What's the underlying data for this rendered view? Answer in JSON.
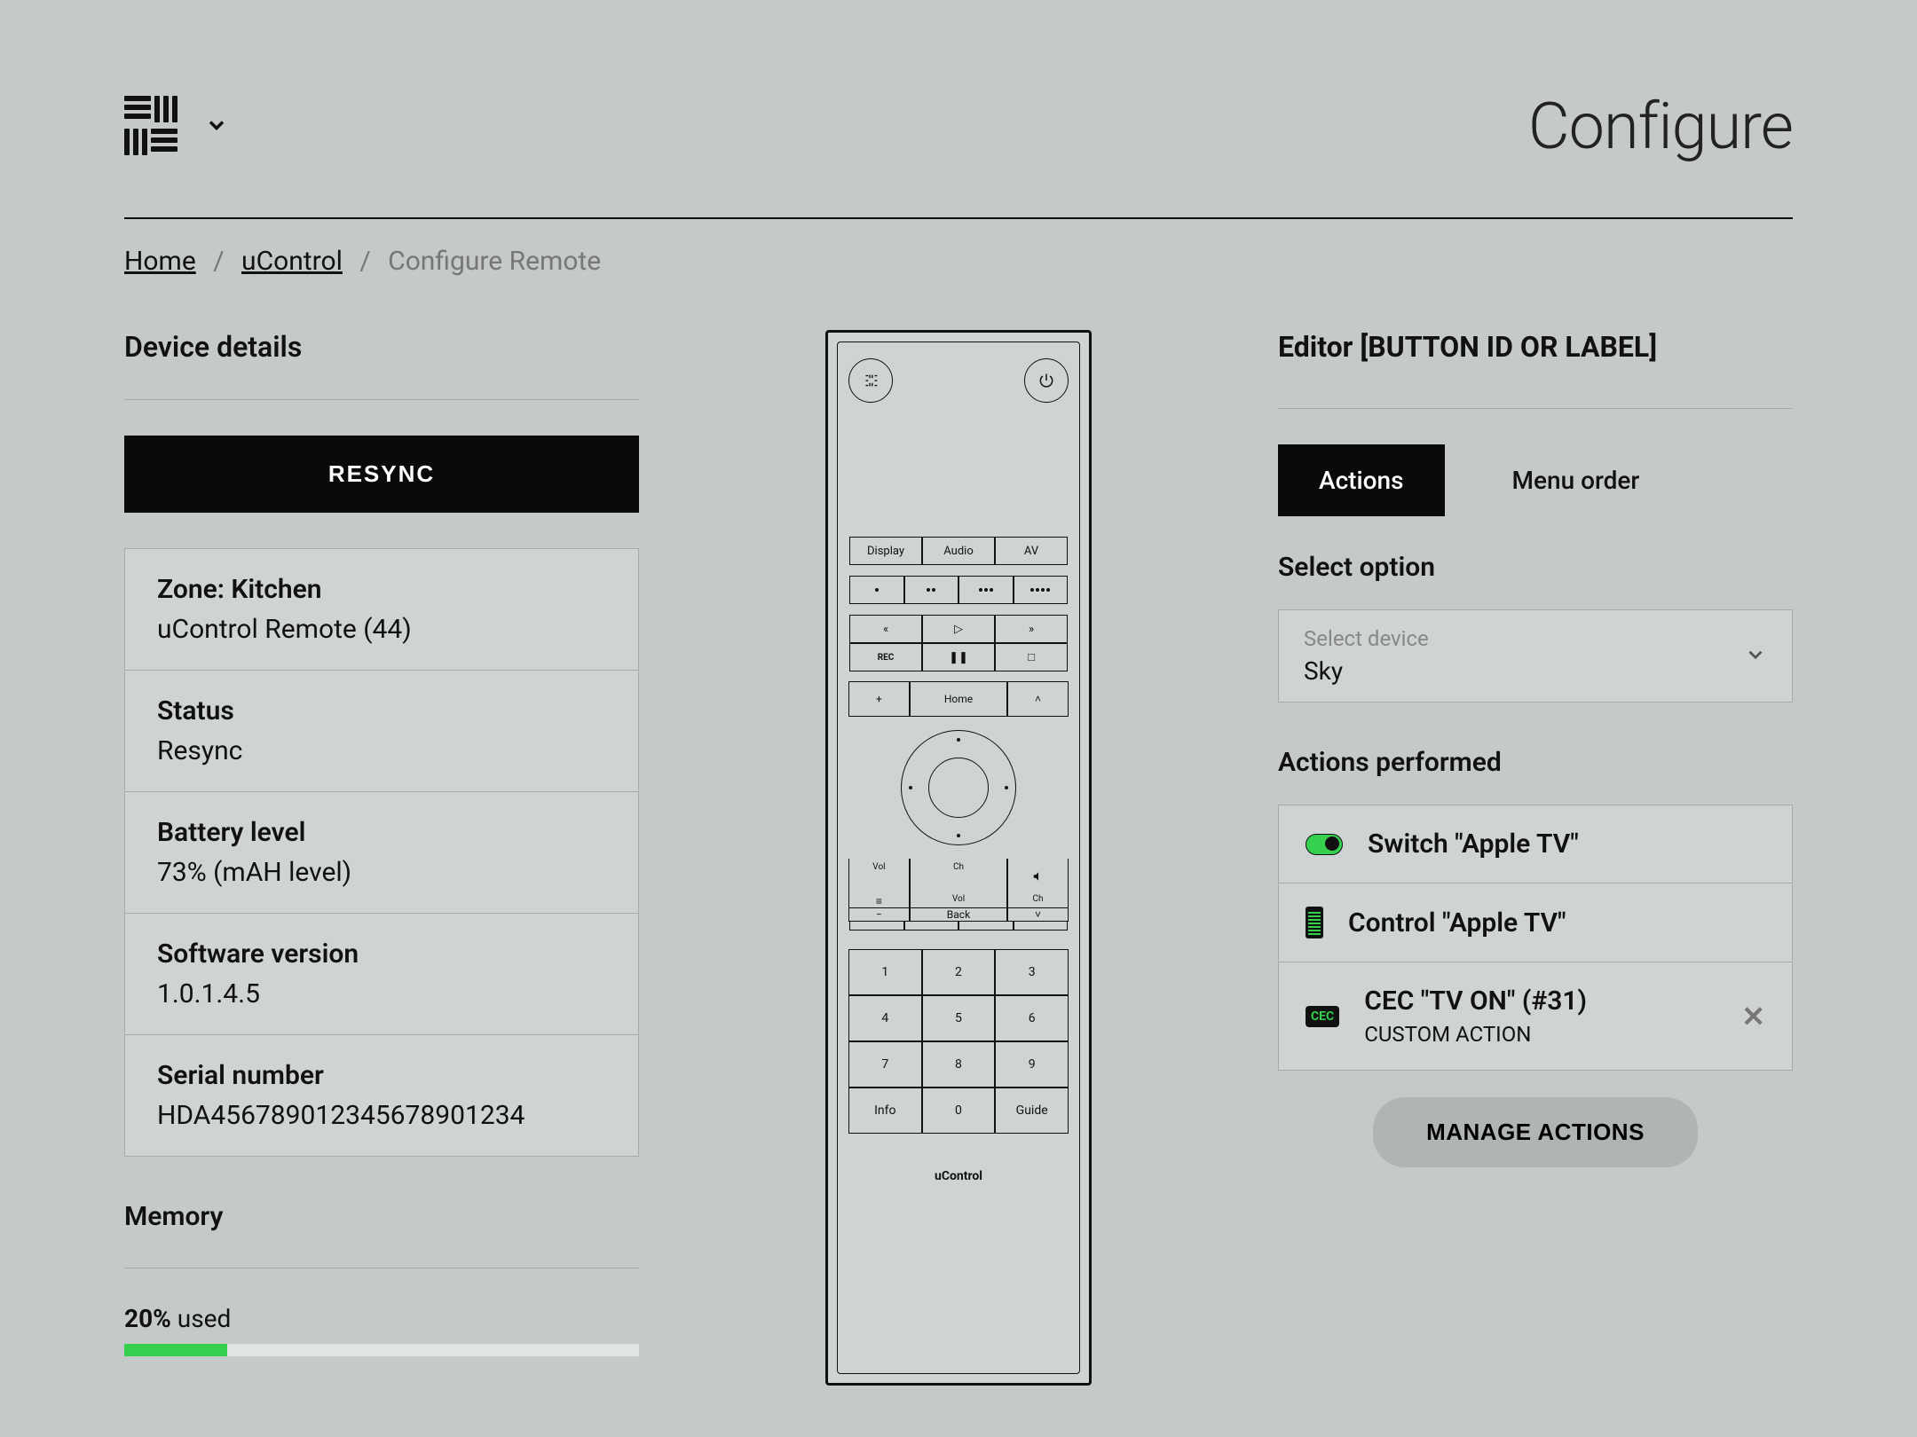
{
  "header": {
    "page_title": "Configure"
  },
  "breadcrumb": {
    "home": "Home",
    "ucontrol": "uControl",
    "current": "Configure Remote"
  },
  "device_details": {
    "title": "Device details",
    "resync_button": "RESYNC",
    "zone_label": "Zone: Kitchen",
    "zone_value": "uControl Remote (44)",
    "status_label": "Status",
    "status_value": "Resync",
    "battery_label": "Battery level",
    "battery_value": "73% (mAH level)",
    "software_label": "Software version",
    "software_value": "1.0.1.4.5",
    "serial_label": "Serial number",
    "serial_value": "HDA456789012345678901234"
  },
  "memory": {
    "title": "Memory",
    "used_pct": "20%",
    "used_label": " used"
  },
  "remote": {
    "display": "Display",
    "audio": "Audio",
    "av": "AV",
    "rec": "REC",
    "home": "Home",
    "vol": "Vol",
    "ch": "Ch",
    "back": "Back",
    "info": "Info",
    "guide": "Guide",
    "brand": "uControl",
    "n1": "1",
    "n2": "2",
    "n3": "3",
    "n4": "4",
    "n5": "5",
    "n6": "6",
    "n7": "7",
    "n8": "8",
    "n9": "9",
    "n0": "0"
  },
  "editor": {
    "title": "Editor [BUTTON ID OR LABEL]",
    "tab_actions": "Actions",
    "tab_menu": "Menu order",
    "select_option": "Select option",
    "select_placeholder": "Select device",
    "select_value": "Sky",
    "actions_performed": "Actions performed",
    "action1": "Switch \"Apple TV\"",
    "action2": "Control \"Apple TV\"",
    "action3_title": "CEC \"TV ON\" (#31)",
    "action3_sub": "CUSTOM ACTION",
    "cec_badge": "CEC",
    "manage": "MANAGE ACTIONS"
  }
}
